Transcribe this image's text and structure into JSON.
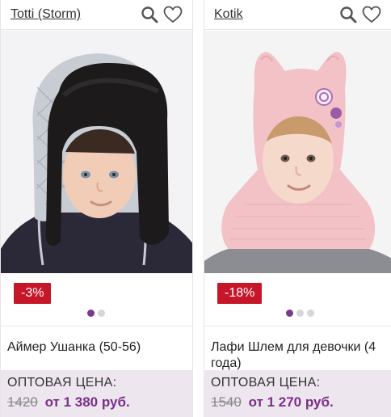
{
  "products": [
    {
      "brand": "Totti (Storm)",
      "discount": "-3%",
      "name": "Аймер Ушанка (50-56)",
      "price_label": "ОПТОВАЯ ЦЕНА:",
      "old_price": "1420",
      "new_price": "от 1 380 руб.",
      "image_dots": 2,
      "active_dot": 1
    },
    {
      "brand": "Kotik",
      "discount": "-18%",
      "name": "Лафи Шлем для девочки (4 года)",
      "price_label": "ОПТОВАЯ ЦЕНА:",
      "old_price": "1540",
      "new_price": "от 1 270 руб.",
      "image_dots": 3,
      "active_dot": 1
    }
  ],
  "icons": {
    "search": "search-icon",
    "favorite": "heart-icon"
  },
  "colors": {
    "badge": "#c6162a",
    "price": "#7a2f88",
    "price_bg": "#ede6ef",
    "active_dot": "#7a3a8a"
  }
}
